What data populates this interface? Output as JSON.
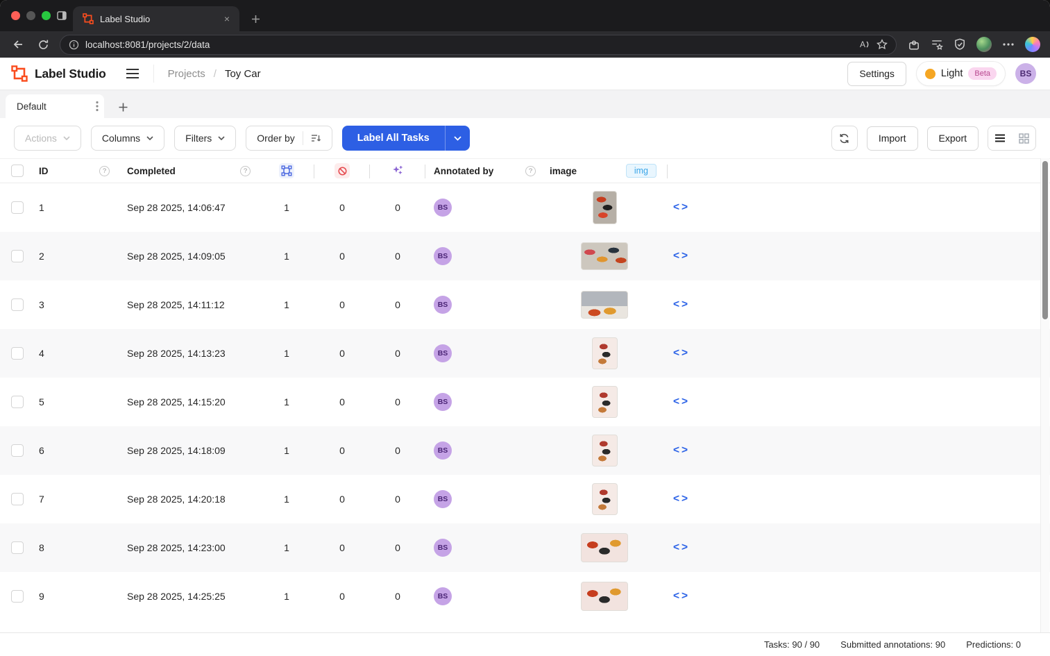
{
  "browser": {
    "tab_title": "Label Studio",
    "url": "localhost:8081/projects/2/data"
  },
  "header": {
    "brand": "Label Studio",
    "breadcrumb_root": "Projects",
    "breadcrumb_sep": "/",
    "breadcrumb_current": "Toy Car",
    "settings_label": "Settings",
    "theme_label": "Light",
    "theme_badge": "Beta",
    "user_initials": "BS"
  },
  "view_tabs": {
    "active_tab": "Default"
  },
  "toolbar": {
    "actions_label": "Actions",
    "columns_label": "Columns",
    "filters_label": "Filters",
    "order_by_label": "Order by",
    "label_all_tasks_label": "Label All Tasks",
    "import_label": "Import",
    "export_label": "Export"
  },
  "table": {
    "columns": {
      "id": "ID",
      "completed": "Completed",
      "annotated_by": "Annotated by",
      "image": "image",
      "image_type_badge": "img"
    },
    "rows": [
      {
        "id": "1",
        "completed": "Sep 28 2025, 14:06:47",
        "annotations": "1",
        "cancellations": "0",
        "predictions": "0",
        "annotator": "BS",
        "thumb": "portrait-dark"
      },
      {
        "id": "2",
        "completed": "Sep 28 2025, 14:09:05",
        "annotations": "1",
        "cancellations": "0",
        "predictions": "0",
        "annotator": "BS",
        "thumb": "wide-gray"
      },
      {
        "id": "3",
        "completed": "Sep 28 2025, 14:11:12",
        "annotations": "1",
        "cancellations": "0",
        "predictions": "0",
        "annotator": "BS",
        "thumb": "wide-kb"
      },
      {
        "id": "4",
        "completed": "Sep 28 2025, 14:13:23",
        "annotations": "1",
        "cancellations": "0",
        "predictions": "0",
        "annotator": "BS",
        "thumb": "portrait-pink"
      },
      {
        "id": "5",
        "completed": "Sep 28 2025, 14:15:20",
        "annotations": "1",
        "cancellations": "0",
        "predictions": "0",
        "annotator": "BS",
        "thumb": "portrait-pink"
      },
      {
        "id": "6",
        "completed": "Sep 28 2025, 14:18:09",
        "annotations": "1",
        "cancellations": "0",
        "predictions": "0",
        "annotator": "BS",
        "thumb": "portrait-pink"
      },
      {
        "id": "7",
        "completed": "Sep 28 2025, 14:20:18",
        "annotations": "1",
        "cancellations": "0",
        "predictions": "0",
        "annotator": "BS",
        "thumb": "portrait-pink"
      },
      {
        "id": "8",
        "completed": "Sep 28 2025, 14:23:00",
        "annotations": "1",
        "cancellations": "0",
        "predictions": "0",
        "annotator": "BS",
        "thumb": "wide-pink"
      },
      {
        "id": "9",
        "completed": "Sep 28 2025, 14:25:25",
        "annotations": "1",
        "cancellations": "0",
        "predictions": "0",
        "annotator": "BS",
        "thumb": "wide-pink"
      }
    ]
  },
  "footer": {
    "tasks": "Tasks: 90 / 90",
    "submitted": "Submitted annotations: 90",
    "predictions": "Predictions: 0"
  },
  "icons": {
    "code": "<>",
    "help": "?",
    "close": "×",
    "plus": "+"
  },
  "colors": {
    "primary_blue": "#2d5fe4",
    "brand_orange": "#fa4d1e",
    "avatar_purple_bg": "#c5a3e6",
    "image_badge_blue": "#39a5e8",
    "cancel_red": "#e5484d",
    "prediction_purple": "#8a63d2",
    "theme_dot_orange": "#f5a623"
  }
}
